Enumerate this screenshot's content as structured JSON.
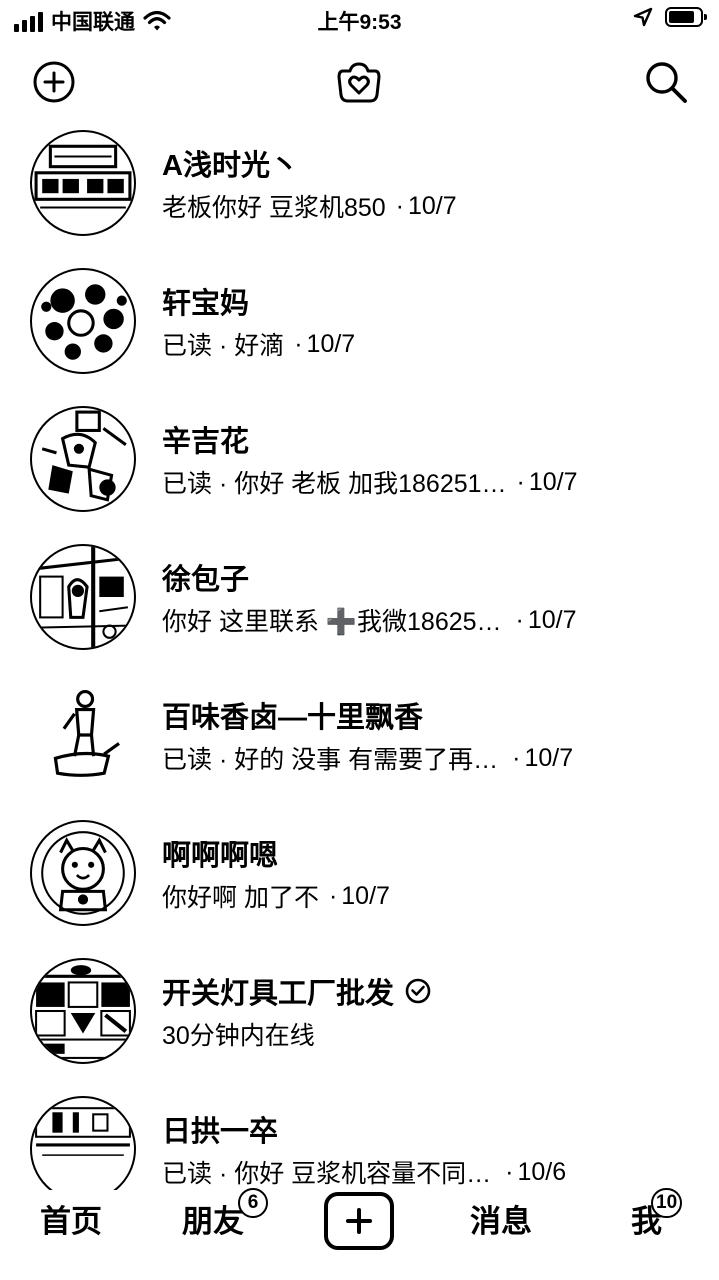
{
  "status": {
    "carrier": "中国联通",
    "time": "上午9:53",
    "battery_level": 0.85,
    "icons": [
      "signal-icon",
      "wifi-icon",
      "location-arrow-icon",
      "battery-icon"
    ]
  },
  "header": {
    "icons": [
      "add-circle-icon",
      "heart-bag-icon",
      "search-icon"
    ]
  },
  "conversations": [
    {
      "name": "A浅时光丶",
      "message": "老板你好 豆浆机850",
      "date": "10/7"
    },
    {
      "name": "轩宝妈",
      "message": "已读 · 好滴",
      "date": "10/7"
    },
    {
      "name": "辛吉花",
      "message": "已读 · 你好 老板 加我186251…",
      "date": "10/7"
    },
    {
      "name": "徐包子",
      "message": "你好 这里联系 ➕我微18625…",
      "date": "10/7"
    },
    {
      "name": "百味香卤—十里飘香",
      "message": "已读 · 好的 没事 有需要了再…",
      "date": "10/7"
    },
    {
      "name": "啊啊啊嗯",
      "message": "你好啊 加了不",
      "date": "10/7"
    },
    {
      "name": "开关灯具工厂批发",
      "message": "30分钟内在线",
      "date": "",
      "verified": true
    },
    {
      "name": "日拱一卒",
      "message": "已读 · 你好 豆浆机容量不同…",
      "date": "10/6"
    }
  ],
  "separator": "·",
  "tabs": {
    "home": "首页",
    "friends": "朋友",
    "friends_badge": "6",
    "messages": "消息",
    "me": "我",
    "me_badge": "10"
  }
}
